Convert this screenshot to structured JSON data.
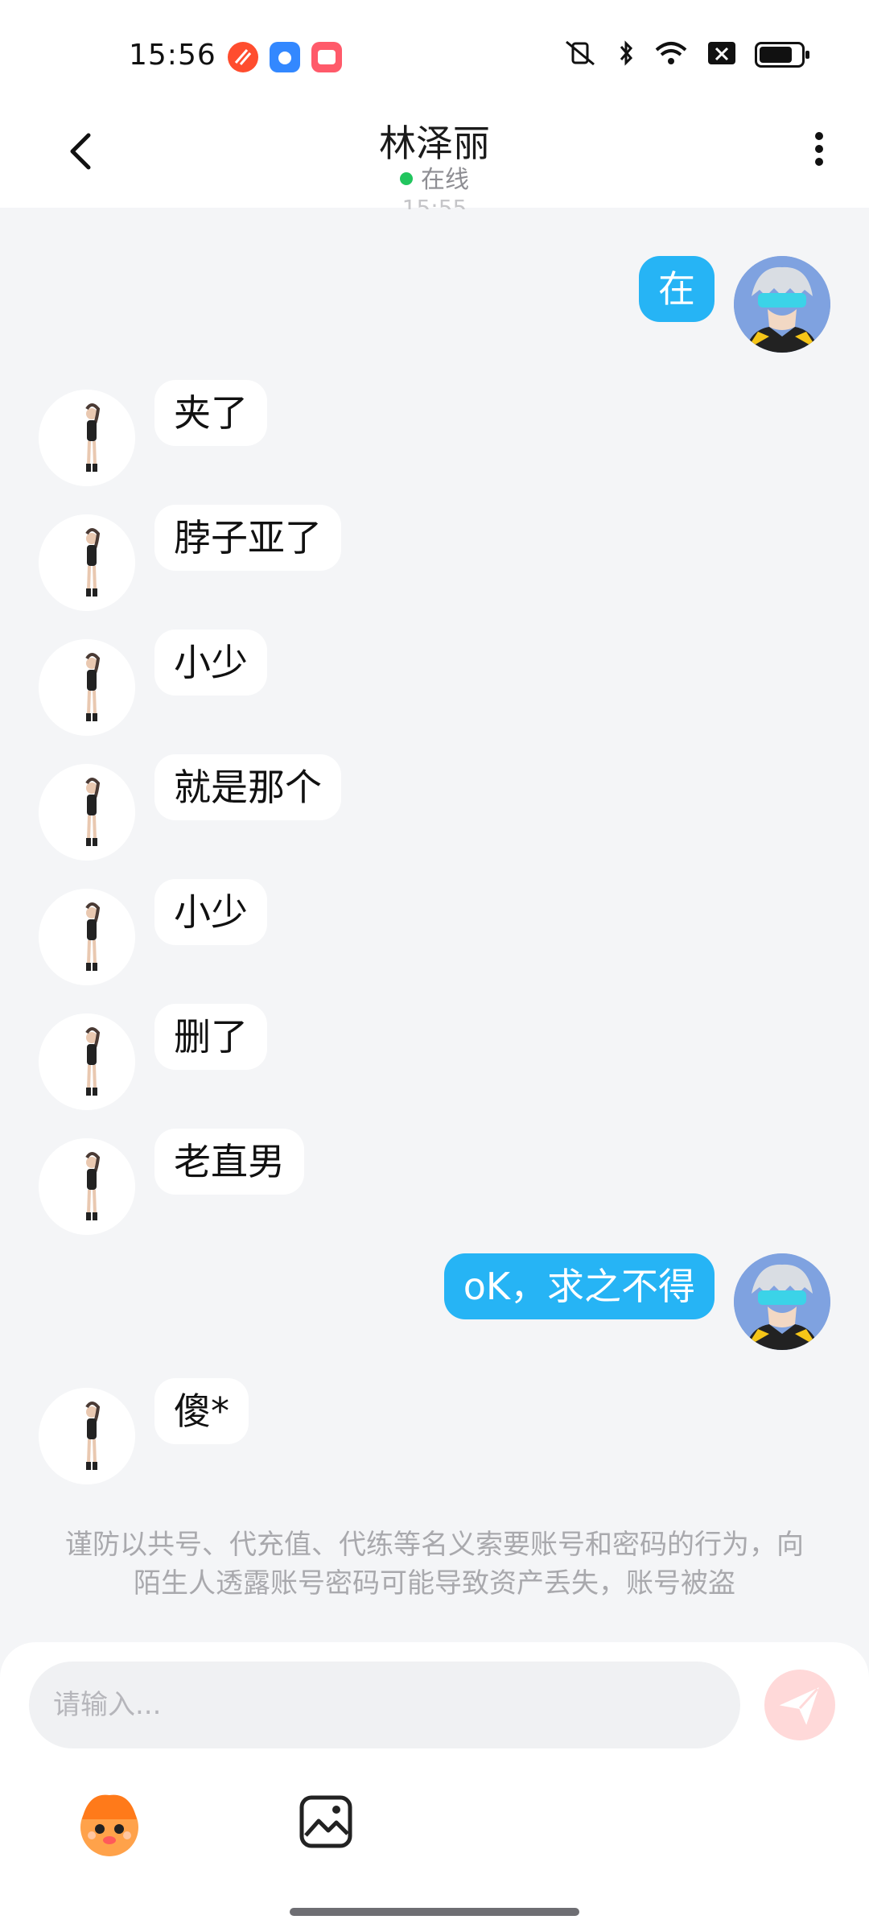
{
  "status_bar": {
    "time": "15:56",
    "apps": [
      {
        "icon": "red-app-icon",
        "color": "#ff4d2e"
      },
      {
        "icon": "baidu-app-icon",
        "color": "#3388ff"
      },
      {
        "icon": "kuaishou-app-icon",
        "color": "#ff5a6a"
      }
    ],
    "icons": [
      "mute-vibrate-icon",
      "bluetooth-icon",
      "wifi-icon",
      "sim-off-icon",
      "battery-icon"
    ]
  },
  "header": {
    "title": "林泽丽",
    "status": "在线"
  },
  "peek_time": "15:55",
  "messages": [
    {
      "side": "out",
      "text": "在"
    },
    {
      "side": "in",
      "text": "夹了"
    },
    {
      "side": "in",
      "text": "脖子亚了"
    },
    {
      "side": "in",
      "text": "小少"
    },
    {
      "side": "in",
      "text": "就是那个"
    },
    {
      "side": "in",
      "text": "小少"
    },
    {
      "side": "in",
      "text": "删了"
    },
    {
      "side": "in",
      "text": "老直男"
    },
    {
      "side": "out",
      "text": "oK，求之不得"
    },
    {
      "side": "in",
      "text": "傻*"
    }
  ],
  "warning": "谨防以共号、代充值、代练等名义索要账号和密码的行为，向陌生人透露账号密码可能导致资产丢失，账号被盗",
  "composer": {
    "placeholder": "请输入..."
  },
  "colors": {
    "accent": "#26b4f5",
    "send": "#ff5d5d",
    "online": "#22c55e"
  }
}
